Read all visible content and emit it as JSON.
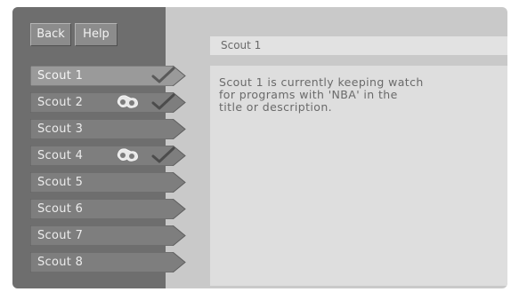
{
  "toolbar": {
    "back_label": "Back",
    "help_label": "Help"
  },
  "scouts": [
    {
      "label": "Scout 1",
      "selected": true,
      "checked": true,
      "watching": false
    },
    {
      "label": "Scout 2",
      "selected": false,
      "checked": true,
      "watching": true
    },
    {
      "label": "Scout 3",
      "selected": false,
      "checked": false,
      "watching": false
    },
    {
      "label": "Scout 4",
      "selected": false,
      "checked": true,
      "watching": true
    },
    {
      "label": "Scout 5",
      "selected": false,
      "checked": false,
      "watching": false
    },
    {
      "label": "Scout 6",
      "selected": false,
      "checked": false,
      "watching": false
    },
    {
      "label": "Scout 7",
      "selected": false,
      "checked": false,
      "watching": false
    },
    {
      "label": "Scout 8",
      "selected": false,
      "checked": false,
      "watching": false
    }
  ],
  "detail": {
    "title": "Scout 1",
    "description": "Scout 1 is currently keeping watch\nfor programs with 'NBA' in the\ntitle or description."
  },
  "colors": {
    "selected_tab": "#9a9a9a",
    "unselected_tab": "#7e7e7e",
    "sidebar": "#6e6e6e",
    "panel": "#dedede"
  }
}
